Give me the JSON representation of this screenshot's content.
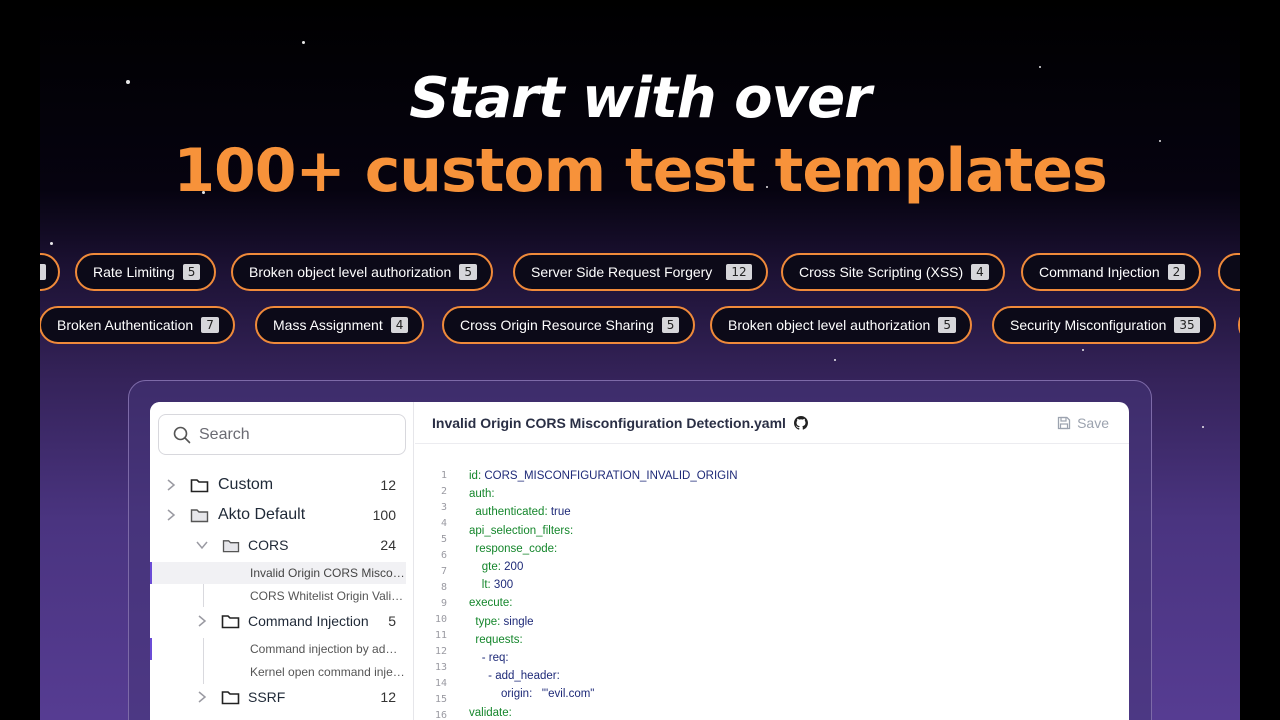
{
  "headline": {
    "line1": "Start with over",
    "line2": "100+ custom test templates"
  },
  "colors": {
    "accent_orange": "#f7923a",
    "pill_border": "#f08a3a",
    "key_green": "#14862b",
    "value_navy": "#1e2a78",
    "selection_accent": "#6b4cd6"
  },
  "categories_row1": [
    {
      "label": "Rate Limiting",
      "count": "5"
    },
    {
      "label": "Broken object level authorization",
      "count": "5"
    },
    {
      "label": "Server Side Request Forgery",
      "count": "12"
    },
    {
      "label": "Cross Site Scripting (XSS)",
      "count": "4"
    },
    {
      "label": "Command Injection",
      "count": "2"
    }
  ],
  "categories_row2": [
    {
      "label": "Broken Authentication",
      "count": "7"
    },
    {
      "label": "Mass Assignment",
      "count": "4"
    },
    {
      "label": "Cross Origin Resource Sharing",
      "count": "5"
    },
    {
      "label": "Broken object level authorization",
      "count": "5"
    },
    {
      "label": "Security Misconfiguration",
      "count": "35"
    }
  ],
  "sidebar": {
    "search_placeholder": "Search",
    "folders": [
      {
        "label": "Custom",
        "count": "12"
      },
      {
        "label": "Akto Default",
        "count": "100"
      },
      {
        "label": "CORS",
        "count": "24"
      },
      {
        "label": "Command Injection",
        "count": "5"
      },
      {
        "label": "SSRF",
        "count": "12"
      }
    ],
    "leaves": [
      "Invalid Origin CORS Misconfiguration Detection",
      "CORS Whitelist Origin Validation",
      "Command injection by adding a query parameter",
      "Kernel open command injection"
    ]
  },
  "editor": {
    "file_name": "Invalid Origin CORS Misconfiguration Detection.yaml",
    "save_label": "Save",
    "line_numbers": [
      "1",
      "2",
      "3",
      "4",
      "5",
      "6",
      "7",
      "8",
      "9",
      "10",
      "11",
      "12",
      "13",
      "14",
      "15",
      "16"
    ],
    "lines": [
      {
        "key": "id:",
        "value": " CORS_MISCONFIGURATION_INVALID_ORIGIN"
      },
      {
        "key": "auth:",
        "value": ""
      },
      {
        "key": "  authenticated:",
        "value": " true"
      },
      {
        "key": "api_selection_filters:",
        "value": ""
      },
      {
        "key": "  response_code:",
        "value": ""
      },
      {
        "key": "    gte:",
        "value": " 200"
      },
      {
        "key": "    lt:",
        "value": " 300"
      },
      {
        "key": "execute:",
        "value": ""
      },
      {
        "key": "  type:",
        "value": " single"
      },
      {
        "key": "  requests:",
        "value": ""
      },
      {
        "key": "",
        "value": "    - req:"
      },
      {
        "key": "",
        "value": "      - add_header:"
      },
      {
        "key": "",
        "value": "          origin:   \"'evil.com\""
      },
      {
        "key": "validate:",
        "value": ""
      }
    ]
  }
}
